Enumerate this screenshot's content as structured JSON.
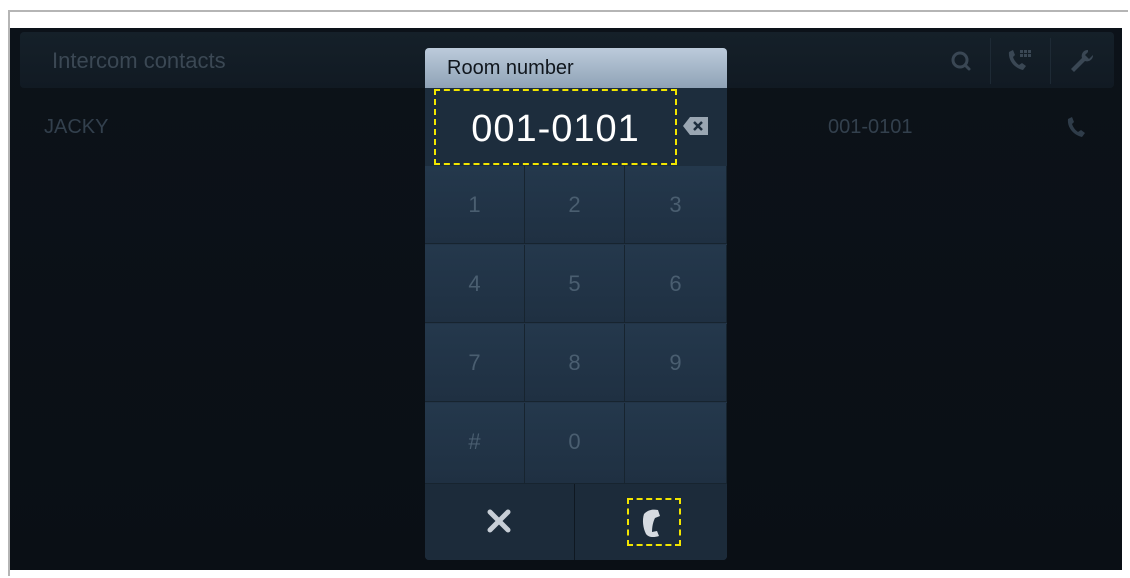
{
  "header": {
    "title": "Intercom contacts",
    "icons": [
      "search-icon",
      "dialpad-call-icon",
      "wrench-icon"
    ]
  },
  "contacts": [
    {
      "name": "JACKY",
      "number": "001-0101"
    }
  ],
  "dialog": {
    "title": "Room number",
    "entered_number": "001-0101",
    "keys": [
      "1",
      "2",
      "3",
      "4",
      "5",
      "6",
      "7",
      "8",
      "9",
      "#",
      "0",
      ""
    ],
    "cancel_icon": "close-icon",
    "call_icon": "phone-handset-icon"
  },
  "colors": {
    "screen_bg": "#0c1219",
    "dialog_bg": "#223447",
    "title_bar": "#a8b8c9",
    "highlight": "#f2e600"
  }
}
